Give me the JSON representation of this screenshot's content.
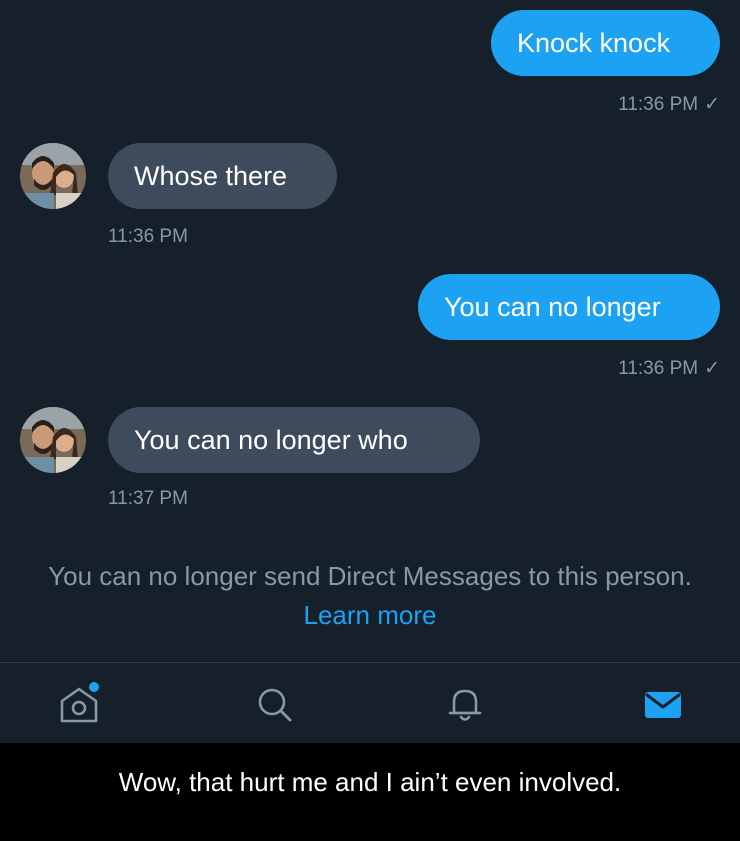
{
  "messages": [
    {
      "text": "Knock knock",
      "time": "11:36 PM",
      "check": "✓"
    },
    {
      "text": "Whose there",
      "time": "11:36 PM"
    },
    {
      "text": "You can no longer",
      "time": "11:36 PM",
      "check": "✓"
    },
    {
      "text": "You can no longer who",
      "time": "11:37 PM"
    }
  ],
  "notice": {
    "text": "You can no longer send Direct Messages to this person.",
    "link": "Learn more"
  },
  "nav": {
    "items": [
      "home-icon",
      "search-icon",
      "notifications-icon",
      "messages-icon"
    ],
    "home_has_dot": true
  },
  "caption": "Wow, that hurt me and I ain’t even involved.",
  "colors": {
    "background": "#15202b",
    "outgoing_bubble": "#1da1f2",
    "incoming_bubble": "#3d4b5c",
    "muted_text": "#8899a6",
    "accent": "#1da1f2"
  }
}
